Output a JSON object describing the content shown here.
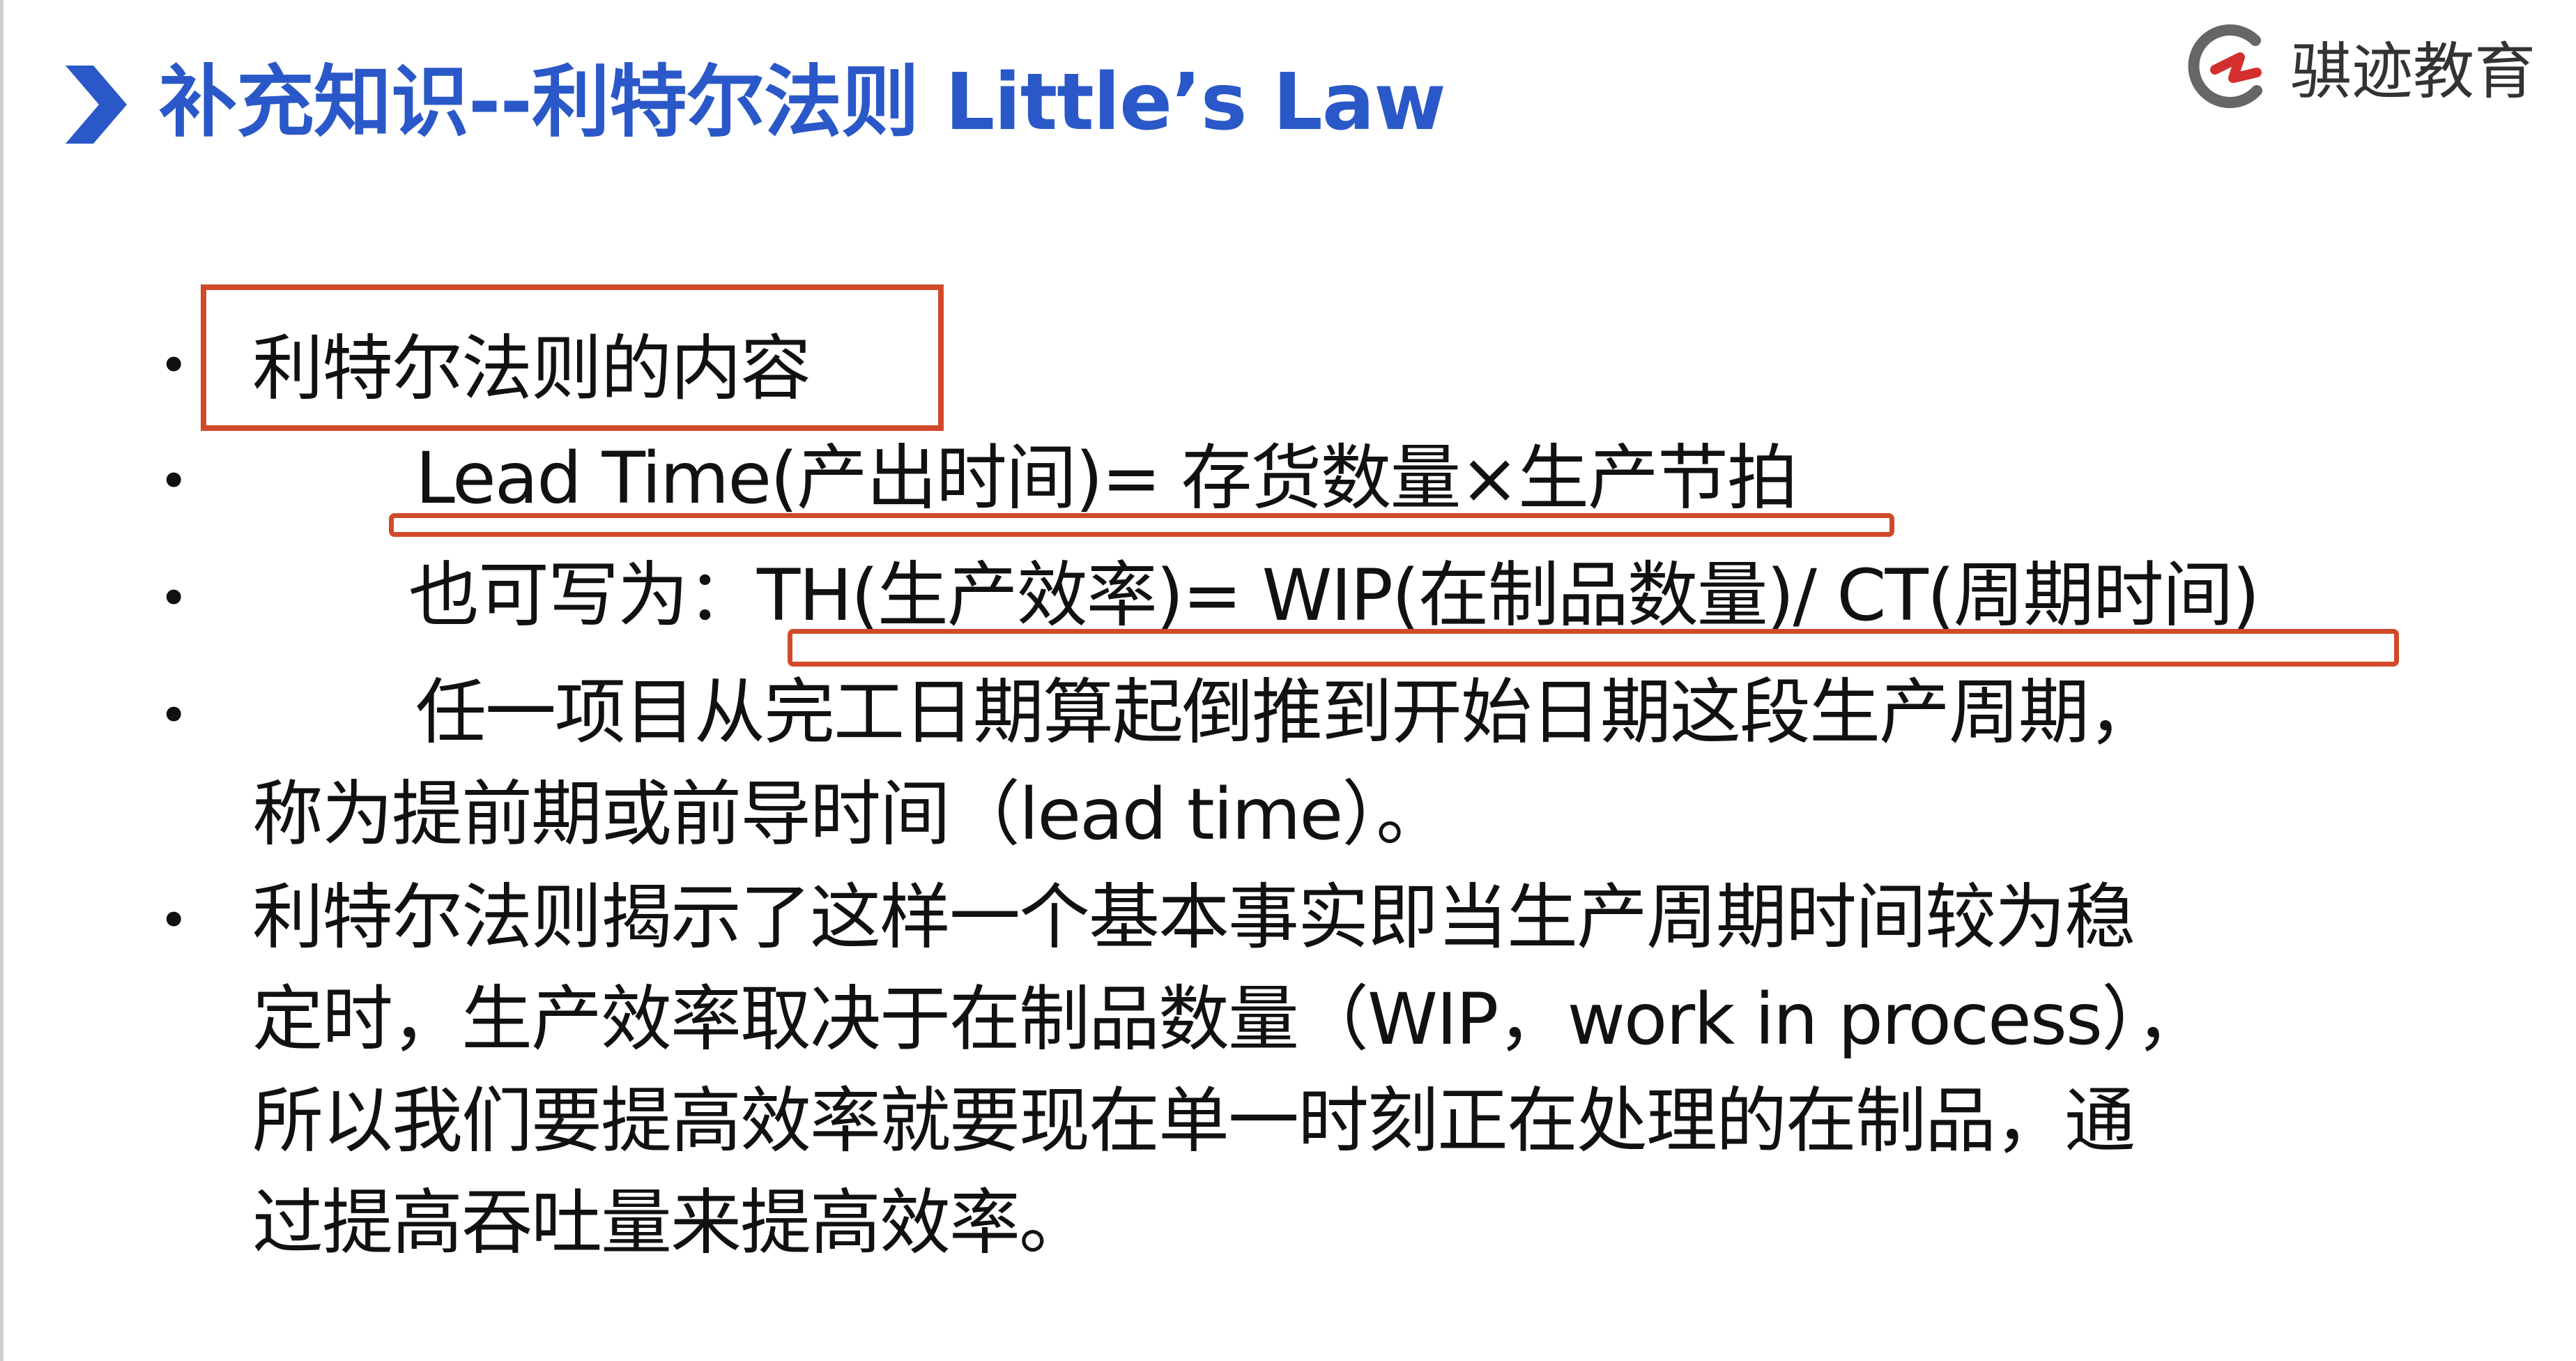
{
  "header": {
    "title": "补充知识--利特尔法则 Little’s Law",
    "logo_text": "骐迹教育"
  },
  "bullets": [
    {
      "lines": [
        "利特尔法则的内容"
      ]
    },
    {
      "lines": [
        "Lead Time(产出时间)= 存货数量×生产节拍"
      ]
    },
    {
      "lines": [
        "也可写为：TH(生产效率)= WIP(在制品数量)/ CT(周期时间)"
      ]
    },
    {
      "lines": [
        "任一项目从完工日期算起倒推到开始日期这段生产周期，",
        "称为提前期或前导时间（lead time）。"
      ]
    },
    {
      "lines": [
        "利特尔法则揭示了这样一个基本事实即当生产周期时间较为稳",
        "定时，生产效率取决于在制品数量（WIP，work in process），",
        "所以我们要提高效率就要现在单一时刻正在处理的在制品，通",
        "过提高吞吐量来提高效率。"
      ]
    }
  ],
  "bullet_symbol": "•",
  "colors": {
    "title": "#2a58c8",
    "annotation": "#d04a2a",
    "body_text": "#111111"
  },
  "icons": [
    "chevron-right-icon",
    "company-logo-icon"
  ]
}
